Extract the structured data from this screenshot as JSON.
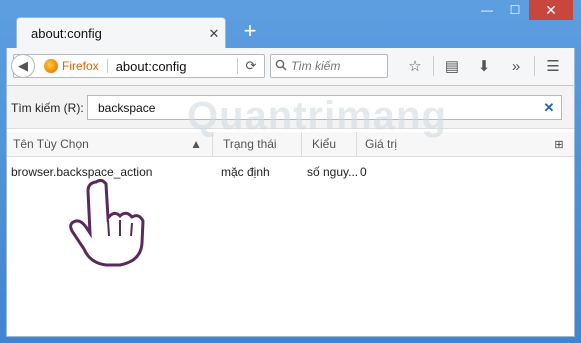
{
  "window": {
    "title": "about:config",
    "close_symbol": "✕",
    "min_symbol": "—",
    "max_symbol": "☐"
  },
  "tabs": [
    {
      "label": "about:config",
      "close_symbol": "✕"
    }
  ],
  "new_tab_symbol": "+",
  "navbar": {
    "identity_label": "Firefox",
    "url": "about:config",
    "search_placeholder": "Tìm kiếm"
  },
  "filter": {
    "label": "Tìm kiếm (R):",
    "value": "backspace"
  },
  "columns": [
    "Tên Tùy Chọn",
    "Trạng thái",
    "Kiểu",
    "Giá trị"
  ],
  "rows": [
    {
      "name": "browser.backspace_action",
      "status": "mặc định",
      "type": "số nguy...",
      "value": "0"
    }
  ],
  "icons": [
    "firefox-icon",
    "back-icon",
    "reload-icon",
    "search-icon",
    "bookmark-star-icon",
    "reading-list-icon",
    "download-icon",
    "overflow-icon",
    "menu-icon",
    "clear-icon",
    "column-picker-icon",
    "sort-arrow-icon",
    "hand-cursor-icon"
  ],
  "colors": {
    "accent": "#1a64b8",
    "frame": "#4a8fd6",
    "close": "#c9463d",
    "firefox": "#e66000"
  },
  "watermark": "Quantrimang"
}
